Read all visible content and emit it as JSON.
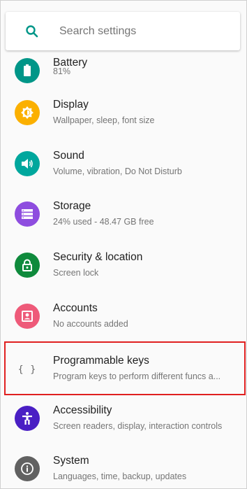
{
  "search": {
    "placeholder": "Search settings",
    "icon": "search-icon"
  },
  "colors": {
    "accent": "#009688",
    "highlight_border": "#e02020"
  },
  "items": [
    {
      "title": "Battery",
      "summary": "81%",
      "icon": "battery-icon",
      "color": "#009688"
    },
    {
      "title": "Display",
      "summary": "Wallpaper, sleep, font size",
      "icon": "brightness-icon",
      "color": "#fbb000"
    },
    {
      "title": "Sound",
      "summary": "Volume, vibration, Do Not Disturb",
      "icon": "volume-icon",
      "color": "#00a79d"
    },
    {
      "title": "Storage",
      "summary": "24% used - 48.47 GB free",
      "icon": "storage-icon",
      "color": "#8e4ddf"
    },
    {
      "title": "Security & location",
      "summary": "Screen lock",
      "icon": "lock-icon",
      "color": "#0f8a3c"
    },
    {
      "title": "Accounts",
      "summary": "No accounts added",
      "icon": "account-box-icon",
      "color": "#ee5a79"
    },
    {
      "title": "Programmable keys",
      "summary": "Program keys to perform different funcs a...",
      "icon": "code-braces-icon",
      "color": "#616161"
    },
    {
      "title": "Accessibility",
      "summary": "Screen readers, display, interaction controls",
      "icon": "accessibility-icon",
      "color": "#4a1fc4"
    },
    {
      "title": "System",
      "summary": "Languages, time, backup, updates",
      "icon": "info-icon",
      "color": "#616161"
    }
  ]
}
